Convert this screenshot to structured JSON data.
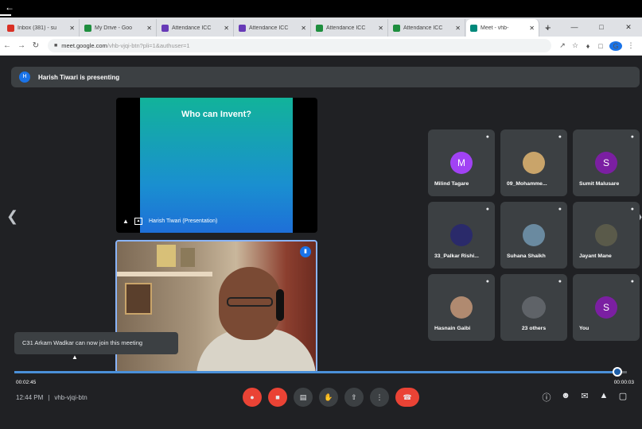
{
  "tabs": [
    {
      "label": "Inbox (381) - su",
      "color": "#d93025"
    },
    {
      "label": "My Drive - Goo",
      "color": "#1e8e3e"
    },
    {
      "label": "Attendance ICC",
      "color": "#673ab7"
    },
    {
      "label": "Attendance ICC",
      "color": "#673ab7"
    },
    {
      "label": "Attendance ICC",
      "color": "#1e8e3e"
    },
    {
      "label": "Attendance ICC",
      "color": "#1e8e3e"
    },
    {
      "label": "Meet - vhb-",
      "color": "#00897b",
      "active": true
    }
  ],
  "address": {
    "host": "meet.google.com",
    "path": "/vhb-vjqi-btn?pli=1&authuser=1"
  },
  "banner": {
    "avatar": "H",
    "text": "Harish Tiwari is presenting"
  },
  "presentation": {
    "slide_title": "Who can Invent?",
    "label": "Harish Tiwari (Presentation)"
  },
  "participants": [
    {
      "name": "Milind Tagare",
      "initial": "M",
      "color": "#a142f4",
      "type": "initial"
    },
    {
      "name": "09_Mohamme...",
      "initial": "",
      "color": "#c9a46a",
      "type": "photo"
    },
    {
      "name": "Sumit Malusare",
      "initial": "S",
      "color": "#7b1fa2",
      "type": "initial"
    },
    {
      "name": "33_Palkar Rishi...",
      "initial": "",
      "color": "#2a2a6a",
      "type": "photo"
    },
    {
      "name": "Suhana Shaikh",
      "initial": "",
      "color": "#6a8aa0",
      "type": "photo"
    },
    {
      "name": "Jayant Mane",
      "initial": "",
      "color": "#5a5a4a",
      "type": "photo"
    },
    {
      "name": "Hasnain Gaibi",
      "initial": "",
      "color": "#b08a70",
      "type": "photo"
    },
    {
      "name": "23 others",
      "initial": "",
      "color": "#5f6368",
      "type": "group"
    },
    {
      "name": "You",
      "initial": "S",
      "color": "#7b1fa2",
      "type": "initial"
    }
  ],
  "toast": "C31 Arkam Wadkar can now join this meeting",
  "player": {
    "elapsed": "00:02:45",
    "total": "00:00:03",
    "progress": 0.985
  },
  "meeting": {
    "time": "12:44 PM",
    "code": "vhb-vjqi-btn"
  }
}
